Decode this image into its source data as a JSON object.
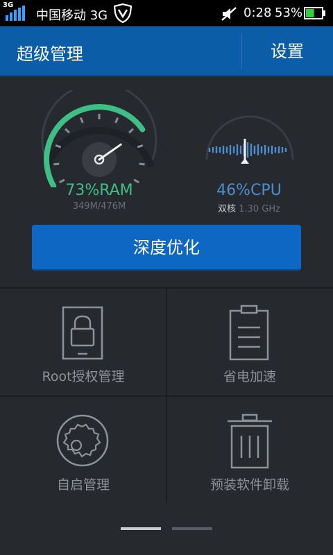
{
  "status_bar": {
    "network": "3G",
    "carrier": "中国移动 3G",
    "time": "0:28",
    "battery_percent": "53%",
    "battery_level": 0.53,
    "icons": [
      "signal-icon",
      "shield-v-icon",
      "mute-icon",
      "battery-icon"
    ]
  },
  "header": {
    "title": "超级管理",
    "settings_label": "设置"
  },
  "gauges": {
    "ram": {
      "label": "73%RAM",
      "detail": "349M/476M",
      "percent": 73,
      "color": "#3fbf86"
    },
    "cpu": {
      "label": "46%CPU",
      "cores": "双核",
      "freq": "1.30 GHz",
      "percent": 46,
      "color": "#4c8fd0"
    }
  },
  "optimize_button": "深度优化",
  "tools": [
    {
      "label": "Root授权管理",
      "icon": "lock-phone-icon"
    },
    {
      "label": "省电加速",
      "icon": "clipboard-icon"
    },
    {
      "label": "自启管理",
      "icon": "gear-icon"
    },
    {
      "label": "预装软件卸载",
      "icon": "trash-icon"
    }
  ],
  "pager": {
    "pages": 2,
    "current": 1
  }
}
